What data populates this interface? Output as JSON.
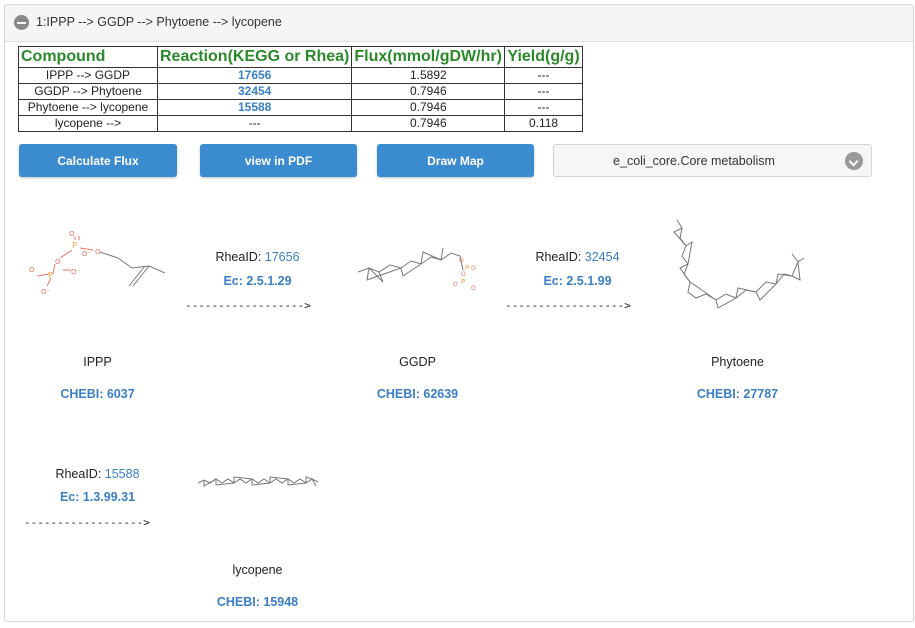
{
  "panel": {
    "title": "1:IPPP --> GGDP --> Phytoene --> lycopene"
  },
  "table": {
    "headers": [
      "Compound",
      "Reaction(KEGG or Rhea)",
      "Flux(mmol/gDW/hr)",
      "Yield(g/g)"
    ],
    "rows": [
      {
        "compound": "IPPP --> GGDP",
        "reaction": "17656",
        "flux": "1.5892",
        "yield": "---"
      },
      {
        "compound": "GGDP --> Phytoene",
        "reaction": "32454",
        "flux": "0.7946",
        "yield": "---"
      },
      {
        "compound": "Phytoene --> lycopene",
        "reaction": "15588",
        "flux": "0.7946",
        "yield": "---"
      },
      {
        "compound": "lycopene -->",
        "reaction": "---",
        "flux": "0.7946",
        "yield": "0.118"
      }
    ]
  },
  "buttons": {
    "calculate": "Calculate Flux",
    "pdf": "view in PDF",
    "map": "Draw Map"
  },
  "model_select": {
    "value": "e_coli_core.Core metabolism"
  },
  "pathway": {
    "compounds": [
      {
        "name": "IPPP",
        "chebi_label": "CHEBI: ",
        "chebi": "6037"
      },
      {
        "name": "GGDP",
        "chebi_label": "CHEBI: ",
        "chebi": "62639"
      },
      {
        "name": "Phytoene",
        "chebi_label": "CHEBI: ",
        "chebi": "27787"
      },
      {
        "name": "lycopene",
        "chebi_label": "CHEBI: ",
        "chebi": "15948"
      }
    ],
    "reactions": [
      {
        "rhea_label": "RheaID: ",
        "rhea": "17656",
        "ec": "Ec: 2.5.1.29",
        "arrow": "------------------>"
      },
      {
        "rhea_label": "RheaID: ",
        "rhea": "32454",
        "ec": "Ec: 2.5.1.99",
        "arrow": "------------------>"
      },
      {
        "rhea_label": "RheaID: ",
        "rhea": "15588",
        "ec": "Ec: 1.3.99.31",
        "arrow": "------------------>"
      }
    ]
  },
  "colors": {
    "accent": "#3a8bd0",
    "link": "#3a7fc5",
    "header_green": "#2a8a2a",
    "oxygen": "#e8756b",
    "phosphorus": "#f0a040",
    "bond": "#777777"
  }
}
